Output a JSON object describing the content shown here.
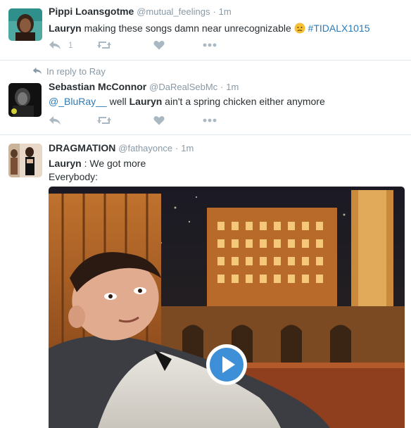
{
  "tweets": [
    {
      "name": "Pippi Loansgotme",
      "handle": "@mutual_feelings",
      "dot": "·",
      "time": "1m",
      "text_bold": "Lauryn",
      "text_rest": " making these songs damn near unrecognizable ",
      "emoji": "disappointed-face-emoji",
      "hashtag": "#TIDALX1015",
      "reply_count": "1"
    },
    {
      "reply_context": "In reply to Ray",
      "name": "Sebastian McConnor",
      "handle": "@DaRealSebMc",
      "dot": "·",
      "time": "1m",
      "mention": "@_BluRay__",
      "text_mid": " well ",
      "text_bold": "Lauryn",
      "text_rest": " ain't a spring chicken either anymore"
    },
    {
      "name": "DRAGMATION",
      "handle": "@fathayonce",
      "dot": "·",
      "time": "1m",
      "text_bold": "Lauryn",
      "text_rest": " : We got more",
      "line2": "Everybody:",
      "media": "video-thumbnail",
      "play_icon": "play-button-icon"
    }
  ],
  "colors": {
    "link": "#2b7bb9",
    "icon_gray": "#aab8c2",
    "meta_gray": "#8899a6",
    "play_blue": "#3d8fd8"
  }
}
